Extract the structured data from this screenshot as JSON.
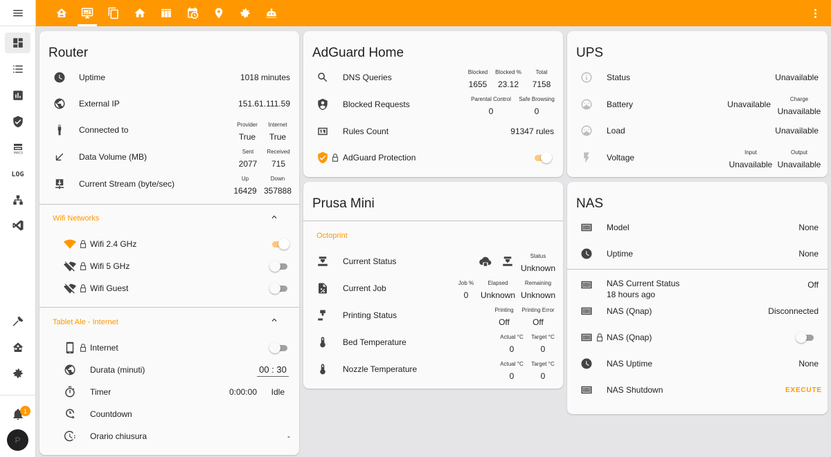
{
  "colors": {
    "accent": "#ff9800",
    "topbar": "#ff9800",
    "background": "#e5e5e7",
    "card": "#fafafa"
  },
  "sidebar": {
    "items": [
      {
        "name": "dashboard",
        "icon": "view-dashboard-icon"
      },
      {
        "name": "list",
        "icon": "format-list-icon"
      },
      {
        "name": "history",
        "icon": "chart-box-icon"
      },
      {
        "name": "adguard",
        "icon": "shield-check-icon"
      },
      {
        "name": "macs",
        "icon": "macs-icon"
      },
      {
        "name": "log",
        "icon": "log-icon",
        "text": "LOG"
      },
      {
        "name": "network",
        "icon": "sitemap-icon"
      },
      {
        "name": "vscode",
        "icon": "vscode-icon"
      },
      {
        "name": "developer-tools",
        "icon": "hammer-icon"
      },
      {
        "name": "home-assistant",
        "icon": "home-assistant-icon"
      },
      {
        "name": "settings",
        "icon": "cog-icon"
      }
    ],
    "notifications_badge": "1",
    "avatar_initial": "P"
  },
  "topbar": {
    "tabs": [
      "home-account-icon",
      "monitor-dashboard-icon",
      "content-copy-icon",
      "home-icon",
      "server-icon",
      "calendar-clock-icon",
      "map-marker-icon",
      "cog-icon",
      "robot-icon"
    ],
    "active_tab": 1
  },
  "router": {
    "title": "Router",
    "uptime": {
      "label": "Uptime",
      "value": "1018 minutes"
    },
    "external_ip": {
      "label": "External IP",
      "value": "151.61.111.59"
    },
    "connected": {
      "label": "Connected to",
      "provider_label": "Provider",
      "provider_value": "True",
      "internet_label": "Internet",
      "internet_value": "True"
    },
    "data_volume": {
      "label": "Data Volume (MB)",
      "sent_label": "Sent",
      "sent_value": "2077",
      "received_label": "Received",
      "received_value": "715"
    },
    "stream": {
      "label": "Current Stream (byte/sec)",
      "up_label": "Up",
      "up_value": "16429",
      "down_label": "Down",
      "down_value": "357888"
    },
    "wifi_section": "Wifi Networks",
    "wifi": [
      {
        "label": "Wifi 2.4 GHz",
        "on": true
      },
      {
        "label": "Wifi 5 GHz",
        "on": false
      },
      {
        "label": "Wifi Guest",
        "on": false
      }
    ],
    "tablet_section": "Tablet Ale - Internet",
    "tablet": {
      "internet_label": "Internet",
      "internet_on": false,
      "durata_label": "Durata (minuti)",
      "durata_value": "00 : 30",
      "timer_label": "Timer",
      "timer_time": "0:00:00",
      "timer_state": "Idle",
      "countdown_label": "Countdown",
      "orario_label": "Orario chiusura",
      "orario_value": "-"
    }
  },
  "adguard": {
    "title": "AdGuard Home",
    "dns": {
      "label": "DNS Queries",
      "blocked_label": "Blocked",
      "blocked_value": "1655",
      "blocked_pct_label": "Blocked %",
      "blocked_pct_value": "23.12",
      "total_label": "Total",
      "total_value": "7158"
    },
    "blocked_requests": {
      "label": "Blocked Requests",
      "parental_label": "Parental Control",
      "parental_value": "0",
      "safe_label": "Safe Browsing",
      "safe_value": "0"
    },
    "rules": {
      "label": "Rules Count",
      "value": "91347 rules"
    },
    "protection": {
      "label": "AdGuard Protection",
      "on": true
    }
  },
  "prusa": {
    "title": "Prusa Mini",
    "section": "Octoprint",
    "current_status": {
      "label": "Current Status",
      "status_label": "Status",
      "status_value": "Unknown"
    },
    "current_job": {
      "label": "Current Job",
      "job_label": "Job %",
      "job_value": "0",
      "elapsed_label": "Elapsed",
      "elapsed_value": "Unknown",
      "remaining_label": "Remaining",
      "remaining_value": "Unknown"
    },
    "printing_status": {
      "label": "Printing Status",
      "printing_label": "Printing",
      "printing_value": "Off",
      "error_label": "Printing Error",
      "error_value": "Off"
    },
    "bed": {
      "label": "Bed Temperature",
      "actual_label": "Actual °C",
      "actual_value": "0",
      "target_label": "Target °C",
      "target_value": "0"
    },
    "nozzle": {
      "label": "Nozzle Temperature",
      "actual_label": "Actual °C",
      "actual_value": "0",
      "target_label": "Target °C",
      "target_value": "0"
    }
  },
  "ups": {
    "title": "UPS",
    "status": {
      "label": "Status",
      "value": "Unavailable"
    },
    "battery": {
      "label": "Battery",
      "value": "Unavailable",
      "charge_label": "Charge",
      "charge_value": "Unavailable"
    },
    "load": {
      "label": "Load",
      "value": "Unavailable"
    },
    "voltage": {
      "label": "Voltage",
      "input_label": "Input",
      "input_value": "Unavailable",
      "output_label": "Output",
      "output_value": "Unavailable"
    }
  },
  "nas": {
    "title": "NAS",
    "model": {
      "label": "Model",
      "value": "None"
    },
    "uptime": {
      "label": "Uptime",
      "value": "None"
    },
    "current_status": {
      "label": "NAS Current Status",
      "secondary": "18 hours ago",
      "value": "Off"
    },
    "qnap1": {
      "label": "NAS (Qnap)",
      "value": "Disconnected"
    },
    "qnap2": {
      "label": "NAS (Qnap)",
      "on": false
    },
    "nas_uptime": {
      "label": "NAS Uptime",
      "value": "None"
    },
    "shutdown": {
      "label": "NAS Shutdown",
      "action": "EXECUTE"
    }
  }
}
